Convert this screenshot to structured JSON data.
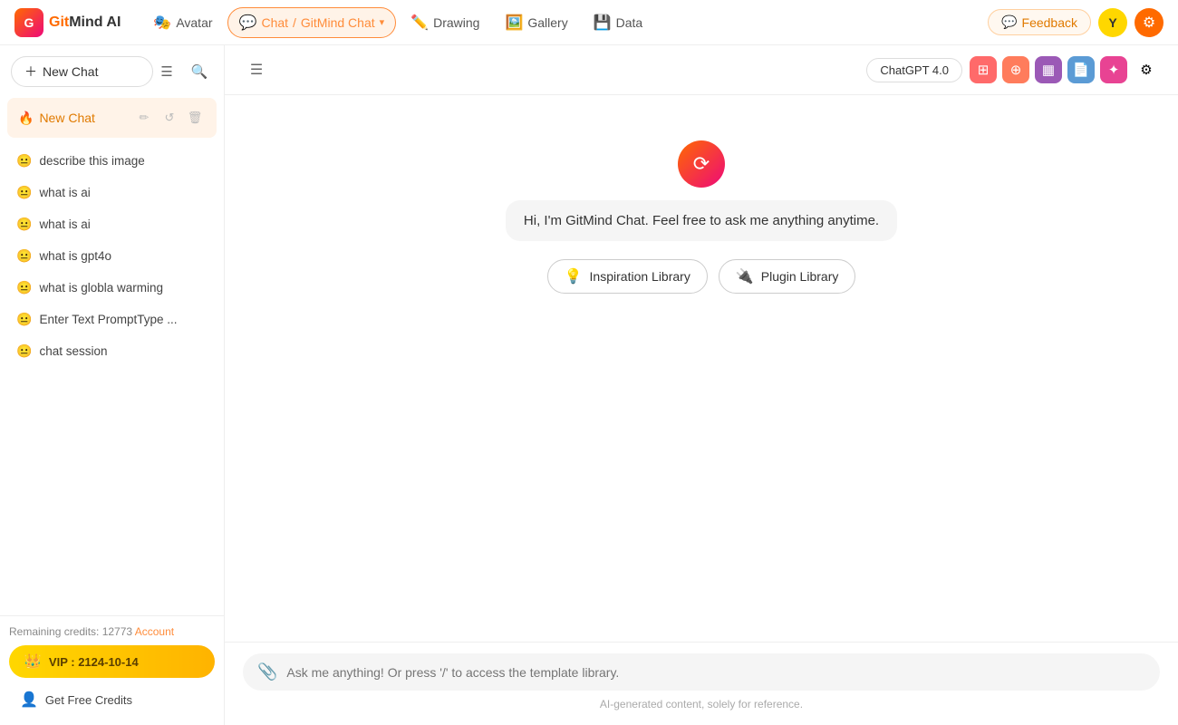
{
  "logo": {
    "icon_text": "G",
    "name": "GitMind AI"
  },
  "topnav": {
    "items": [
      {
        "id": "avatar",
        "icon": "🎭",
        "label": "Avatar",
        "active": false
      },
      {
        "id": "chat",
        "icon": "💬",
        "label": "Chat",
        "active": true
      },
      {
        "id": "gitmind-chat",
        "label": "GitMind Chat",
        "active": true
      },
      {
        "id": "drawing",
        "icon": "✏️",
        "label": "Drawing",
        "active": false
      },
      {
        "id": "gallery",
        "icon": "🖼️",
        "label": "Gallery",
        "active": false
      },
      {
        "id": "data",
        "icon": "💾",
        "label": "Data",
        "active": false
      }
    ],
    "feedback_label": "Feedback",
    "avatar_letter": "Y"
  },
  "sidebar": {
    "new_chat_label": "New Chat",
    "active_chat": {
      "icon": "🔥",
      "label": "New Chat"
    },
    "chat_list": [
      {
        "id": "1",
        "text": "describe this image"
      },
      {
        "id": "2",
        "text": "what is ai"
      },
      {
        "id": "3",
        "text": "what is ai"
      },
      {
        "id": "4",
        "text": "what is gpt4o"
      },
      {
        "id": "5",
        "text": "what is globla warming"
      },
      {
        "id": "6",
        "text": "Enter Text PromptType ..."
      },
      {
        "id": "7",
        "text": "chat session"
      }
    ],
    "credits_text": "Remaining credits: 12773",
    "account_label": "Account",
    "vip_label": "VIP : 2124-10-14",
    "get_free_credits_label": "Get Free Credits"
  },
  "chat": {
    "model_label": "ChatGPT 4.0",
    "welcome_message": "Hi, I'm GitMind Chat. Feel free to ask me anything anytime.",
    "inspiration_library_label": "Inspiration Library",
    "plugin_library_label": "Plugin Library",
    "input_placeholder": "Ask me anything! Or press '/' to access the template library.",
    "footer_note": "AI-generated content, solely for reference."
  }
}
